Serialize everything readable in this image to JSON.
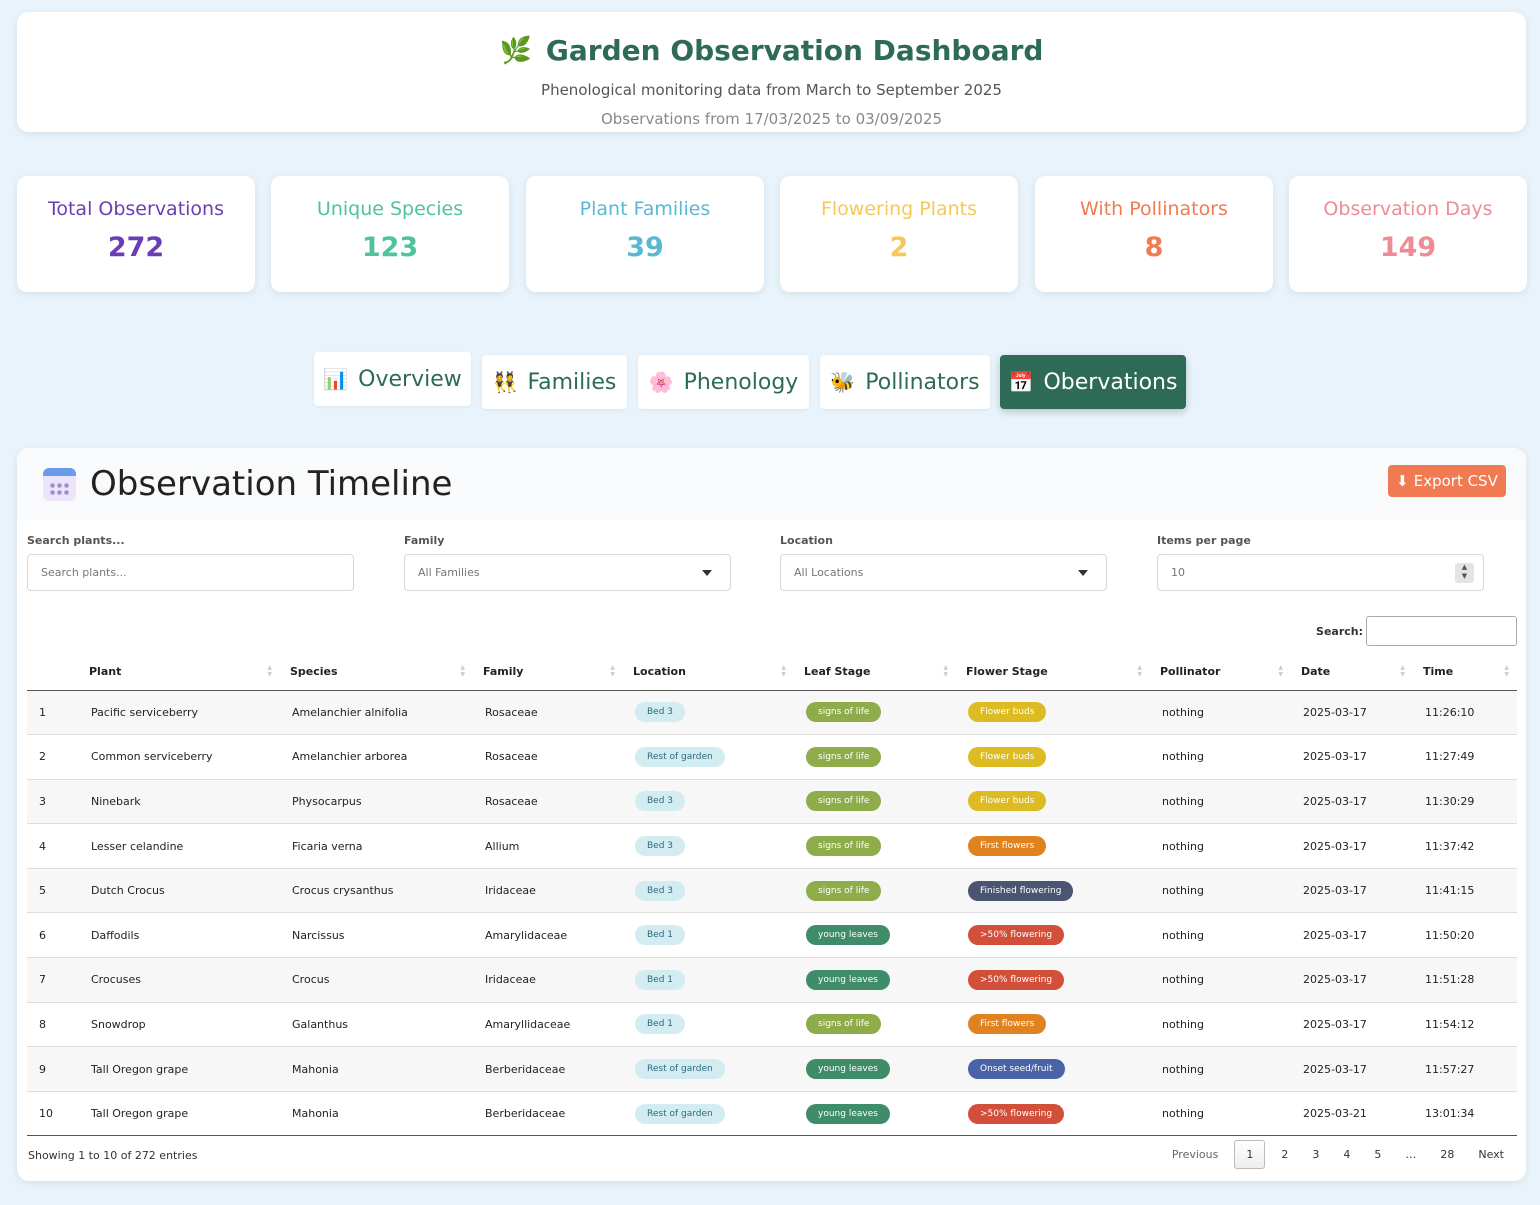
{
  "header": {
    "title": "Garden Observation Dashboard",
    "subtitle": "Phenological monitoring data from March to September 2025",
    "range": "Observations from 17/03/2025 to 03/09/2025"
  },
  "stats": [
    {
      "label": "Total Observations",
      "value": "272",
      "color": "#6a3fb5"
    },
    {
      "label": "Unique Species",
      "value": "123",
      "color": "#4fc49a"
    },
    {
      "label": "Plant Families",
      "value": "39",
      "color": "#5ab8d4"
    },
    {
      "label": "Flowering Plants",
      "value": "2",
      "color": "#f6c85a"
    },
    {
      "label": "With Pollinators",
      "value": "8",
      "color": "#f07b52"
    },
    {
      "label": "Observation Days",
      "value": "149",
      "color": "#ee8c96"
    }
  ],
  "tabs": [
    {
      "label": "Overview",
      "icon": "📊"
    },
    {
      "label": "Families",
      "icon": "👯"
    },
    {
      "label": "Phenology",
      "icon": "🌸"
    },
    {
      "label": "Pollinators",
      "icon": "🐝"
    },
    {
      "label": "Obervations",
      "icon": "📅"
    }
  ],
  "panel": {
    "title": "Observation Timeline",
    "export_label": "Export CSV"
  },
  "filters": {
    "search_label": "Search plants...",
    "search_placeholder": "Search plants...",
    "family_label": "Family",
    "family_value": "All Families",
    "location_label": "Location",
    "location_value": "All Locations",
    "items_label": "Items per page",
    "items_value": "10"
  },
  "table": {
    "search_label": "Search:",
    "columns": [
      "",
      "Plant",
      "Species",
      "Family",
      "Location",
      "Leaf Stage",
      "Flower Stage",
      "Pollinator",
      "Date",
      "Time"
    ],
    "rows": [
      {
        "n": "1",
        "plant": "Pacific serviceberry",
        "species": "Amelanchier alnifolia",
        "family": "Rosaceae",
        "location": "Bed 3",
        "leaf": "signs of life",
        "flower": "Flower buds",
        "pollinator": "nothing",
        "date": "2025-03-17",
        "time": "11:26:10"
      },
      {
        "n": "2",
        "plant": "Common serviceberry",
        "species": "Amelanchier arborea",
        "family": "Rosaceae",
        "location": "Rest of garden",
        "leaf": "signs of life",
        "flower": "Flower buds",
        "pollinator": "nothing",
        "date": "2025-03-17",
        "time": "11:27:49"
      },
      {
        "n": "3",
        "plant": "Ninebark",
        "species": "Physocarpus",
        "family": "Rosaceae",
        "location": "Bed 3",
        "leaf": "signs of life",
        "flower": "Flower buds",
        "pollinator": "nothing",
        "date": "2025-03-17",
        "time": "11:30:29"
      },
      {
        "n": "4",
        "plant": "Lesser celandine",
        "species": "Ficaria verna",
        "family": "Allium",
        "location": "Bed 3",
        "leaf": "signs of life",
        "flower": "First flowers",
        "pollinator": "nothing",
        "date": "2025-03-17",
        "time": "11:37:42"
      },
      {
        "n": "5",
        "plant": "Dutch Crocus",
        "species": "Crocus crysanthus",
        "family": "Iridaceae",
        "location": "Bed 3",
        "leaf": "signs of life",
        "flower": "Finished flowering",
        "pollinator": "nothing",
        "date": "2025-03-17",
        "time": "11:41:15"
      },
      {
        "n": "6",
        "plant": "Daffodils",
        "species": "Narcissus",
        "family": "Amarylidaceae",
        "location": "Bed 1",
        "leaf": "young leaves",
        "flower": ">50% flowering",
        "pollinator": "nothing",
        "date": "2025-03-17",
        "time": "11:50:20"
      },
      {
        "n": "7",
        "plant": "Crocuses",
        "species": "Crocus",
        "family": "Iridaceae",
        "location": "Bed 1",
        "leaf": "young leaves",
        "flower": ">50% flowering",
        "pollinator": "nothing",
        "date": "2025-03-17",
        "time": "11:51:28"
      },
      {
        "n": "8",
        "plant": "Snowdrop",
        "species": "Galanthus",
        "family": "Amaryllidaceae",
        "location": "Bed 1",
        "leaf": "signs of life",
        "flower": "First flowers",
        "pollinator": "nothing",
        "date": "2025-03-17",
        "time": "11:54:12"
      },
      {
        "n": "9",
        "plant": "Tall Oregon grape",
        "species": "Mahonia",
        "family": "Berberidaceae",
        "location": "Rest of garden",
        "leaf": "young leaves",
        "flower": "Onset seed/fruit",
        "pollinator": "nothing",
        "date": "2025-03-17",
        "time": "11:57:27"
      },
      {
        "n": "10",
        "plant": "Tall Oregon grape",
        "species": "Mahonia",
        "family": "Berberidaceae",
        "location": "Rest of garden",
        "leaf": "young leaves",
        "flower": ">50% flowering",
        "pollinator": "nothing",
        "date": "2025-03-21",
        "time": "13:01:34"
      }
    ]
  },
  "stage_colors": {
    "signs of life": "#8fac4a",
    "young leaves": "#3e8c68",
    "Flower buds": "#dcbc22",
    "First flowers": "#e0821f",
    "Finished flowering": "#4a5572",
    "&gt;50% flowering": "#d24f3a",
    ">50% flowering": "#d24f3a",
    "Onset seed/fruit": "#4a63a6"
  },
  "footer": {
    "info": "Showing 1 to 10 of 272 entries",
    "previous": "Previous",
    "next": "Next",
    "pages": [
      "1",
      "2",
      "3",
      "4",
      "5",
      "…",
      "28"
    ]
  }
}
